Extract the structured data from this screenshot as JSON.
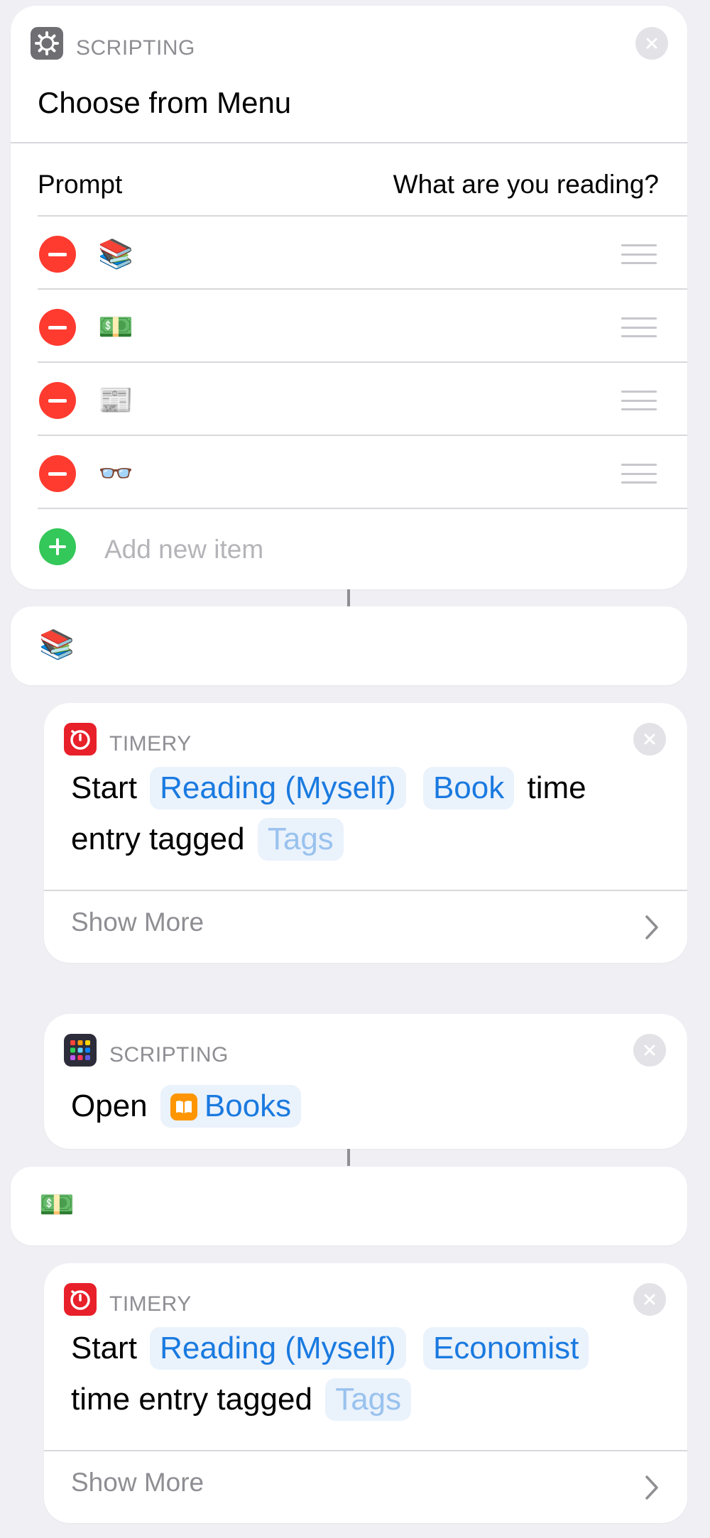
{
  "menu_card": {
    "app_label": "SCRIPTING",
    "app_icon": "gear-icon",
    "title": "Choose from Menu",
    "prompt_label": "Prompt",
    "prompt_value": "What are you reading?",
    "items": [
      {
        "emoji": "📚"
      },
      {
        "emoji": "💵"
      },
      {
        "emoji": "📰"
      },
      {
        "emoji": "👓"
      }
    ],
    "add_item_label": "Add new item"
  },
  "case_1": {
    "emoji": "📚"
  },
  "timery_1": {
    "app_label": "TIMERY",
    "word_start": "Start",
    "project_token": "Reading (Myself)",
    "description_token": "Book",
    "word_time": "time",
    "word_entry_tagged": "entry tagged",
    "tags_token": "Tags",
    "show_more": "Show More"
  },
  "open_app": {
    "app_label": "SCRIPTING",
    "word_open": "Open",
    "app_token": "Books"
  },
  "case_2": {
    "emoji": "💵"
  },
  "timery_2": {
    "app_label": "TIMERY",
    "word_start": "Start",
    "project_token": "Reading (Myself)",
    "description_token": "Economist",
    "word_time_entry_tagged": "time entry tagged",
    "tags_token": "Tags",
    "show_more": "Show More"
  },
  "colors": {
    "background": "#efeff4",
    "token_text": "#1a7ae0",
    "token_bg": "#eaf2fc",
    "delete_red": "#ff3b30",
    "add_green": "#34c759",
    "timery_red": "#e8202a"
  }
}
